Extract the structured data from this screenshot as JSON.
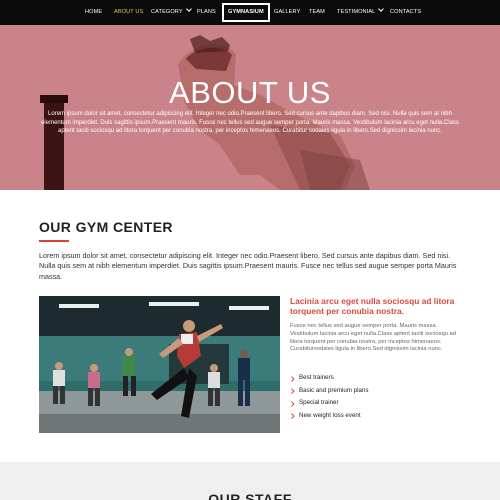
{
  "nav": {
    "items": [
      {
        "label": "HOME",
        "state": "normal",
        "has_dropdown": false
      },
      {
        "label": "ABOUT US",
        "state": "active",
        "has_dropdown": false
      },
      {
        "label": "CATEGORY",
        "state": "normal",
        "has_dropdown": true
      },
      {
        "label": "PLANS",
        "state": "normal",
        "has_dropdown": false
      },
      {
        "label": "GYMNASIUM",
        "state": "boxed",
        "has_dropdown": false
      },
      {
        "label": "GALLERY",
        "state": "normal",
        "has_dropdown": false
      },
      {
        "label": "TEAM",
        "state": "normal",
        "has_dropdown": false
      },
      {
        "label": "TESTIMONIAL",
        "state": "normal",
        "has_dropdown": true
      },
      {
        "label": "CONTACTS",
        "state": "normal",
        "has_dropdown": false
      }
    ]
  },
  "hero": {
    "title": "ABOUT US",
    "text": "Lorem ipsum dolor sit amet, consectetur adipiscing elit. Integer nec odio.Praesent libero. Sed cursus ante dapibus diam. Sed nisi. Nulla quis sem at nibh elementum imperdiet. Duis sagittis ipsum.Praesent mauris. Fusce nec tellus sed augue semper porta. Mauris massa. Vestibulum lacinia arcu eget nulla.Class aptent taciti sociosqu ad litora torquent per conubia nostra, per inceptos himenaeos. Curabitur sodales ligula in libero.Sed dignissim lacinia nunc."
  },
  "gym_center": {
    "title": "OUR GYM CENTER",
    "intro": "Lorem ipsum dolor sit amet, consectetur adipiscing elit. Integer nec odio.Praesent libero. Sed cursus ante dapibus diam. Sed nisi. Nulla quis sem at nibh elementum imperdiet. Duis sagittis ipsum.Praesent mauris. Fusce nec tellus sed augue semper porta Mauris massa.",
    "aside_title": "Lacinia arcu eget nulla sociosqu ad litora torquent per conubia nostra.",
    "aside_text": "Fusce nec tellus sed augue semper porta. Mauris massa. Vestibulum lacinia arcu eget nulla.Class aptent taciti sociosqu ad litora torquent per conubia nostra, per inceptos himenaeos. Curabitursodales ligula in libero.Sed dignissim lacinia nunc.",
    "bullets": [
      "Best trainers",
      "Basic and premium plans",
      "Special trainer",
      "New weight loss event"
    ]
  },
  "staff": {
    "title": "OUR STAFF"
  },
  "colors": {
    "nav_bg": "#0b0b0b",
    "nav_active": "#e8c14a",
    "hero_overlay": "#c98389",
    "accent": "#d84a3c"
  },
  "icons": {
    "dropdown": "chevron-down-icon",
    "bullet": "chevron-right-icon"
  }
}
